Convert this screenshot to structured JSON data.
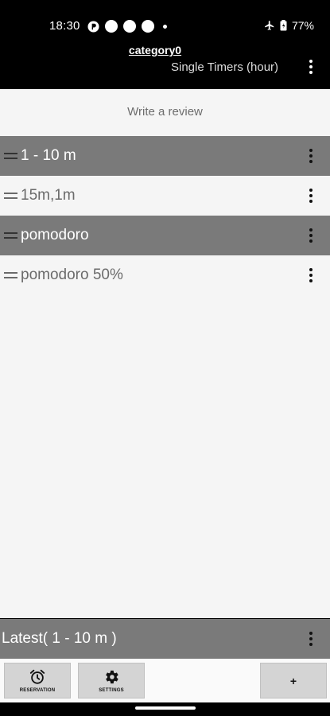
{
  "status_bar": {
    "time": "18:30",
    "battery": "77%"
  },
  "app_bar": {
    "title": "category0",
    "subtitle": "Single Timers (hour)"
  },
  "review_link": "Write a review",
  "timers": [
    {
      "label": "1 - 10 m",
      "style": "dark"
    },
    {
      "label": "15m,1m",
      "style": "light"
    },
    {
      "label": "pomodoro",
      "style": "dark"
    },
    {
      "label": "pomodoro 50%",
      "style": "light"
    }
  ],
  "latest": {
    "label": "Latest( 1 - 10 m )"
  },
  "bottom_bar": {
    "reservation_label": "RESERVATION",
    "settings_label": "SETTINGS",
    "add_label": "+"
  },
  "colors": {
    "dark_row": "#7a7a7a",
    "light_row": "#f5f5f5",
    "app_bar": "#000000"
  }
}
